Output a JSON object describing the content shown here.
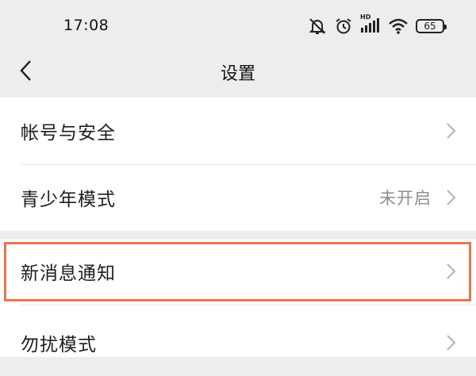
{
  "status_bar": {
    "time": "17:08",
    "network_label": "HD",
    "battery_level": "65",
    "icons": [
      "mute-icon",
      "alarm-icon",
      "signal-icon",
      "wifi-icon",
      "battery-icon"
    ]
  },
  "nav": {
    "title": "设置",
    "back_icon": "chevron-left-icon"
  },
  "settings": {
    "items": [
      {
        "label": "帐号与安全",
        "value": ""
      },
      {
        "label": "青少年模式",
        "value": "未开启"
      },
      {
        "label": "新消息通知",
        "value": "",
        "highlighted": true
      },
      {
        "label": "勿扰模式",
        "value": ""
      }
    ]
  },
  "colors": {
    "background": "#ededed",
    "card": "#ffffff",
    "highlight": "#ee7349",
    "secondary_text": "#8e8e8e"
  }
}
